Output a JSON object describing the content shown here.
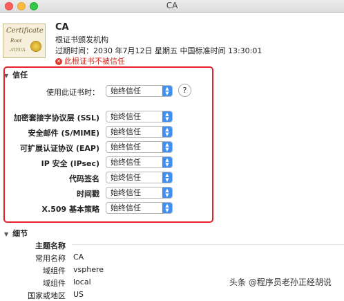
{
  "window": {
    "title": "CA"
  },
  "certificate": {
    "icon_lines": [
      "Certificate",
      "Root",
      "-ATEUA-"
    ],
    "name": "CA",
    "type": "根证书颁发机构",
    "expires": "过期时间：2030 年7月12日 星期五 中国标准时间 13:30:01",
    "warning": "此根证书不被信任"
  },
  "trust": {
    "section_label": "信任",
    "use_label": "使用此证书时：",
    "use_value": "始终信任",
    "help_label": "?",
    "rows": [
      {
        "label": "加密套接字协议层 (SSL)",
        "value": "始终信任"
      },
      {
        "label": "安全邮件 (S/MIME)",
        "value": "始终信任"
      },
      {
        "label": "可扩展认证协议 (EAP)",
        "value": "始终信任"
      },
      {
        "label": "IP 安全 (IPsec)",
        "value": "始终信任"
      },
      {
        "label": "代码签名",
        "value": "始终信任"
      },
      {
        "label": "时间戳",
        "value": "始终信任"
      },
      {
        "label": "X.509 基本策略",
        "value": "始终信任"
      }
    ]
  },
  "details": {
    "section_label": "细节",
    "subject_heading": "主题名称",
    "rows": [
      {
        "key": "常用名称",
        "value": "CA"
      },
      {
        "key": "域组件",
        "value": "vsphere"
      },
      {
        "key": "域组件",
        "value": "local"
      },
      {
        "key": "国家或地区",
        "value": "US"
      }
    ]
  },
  "watermark": "头条 @程序员老孙正经胡说"
}
